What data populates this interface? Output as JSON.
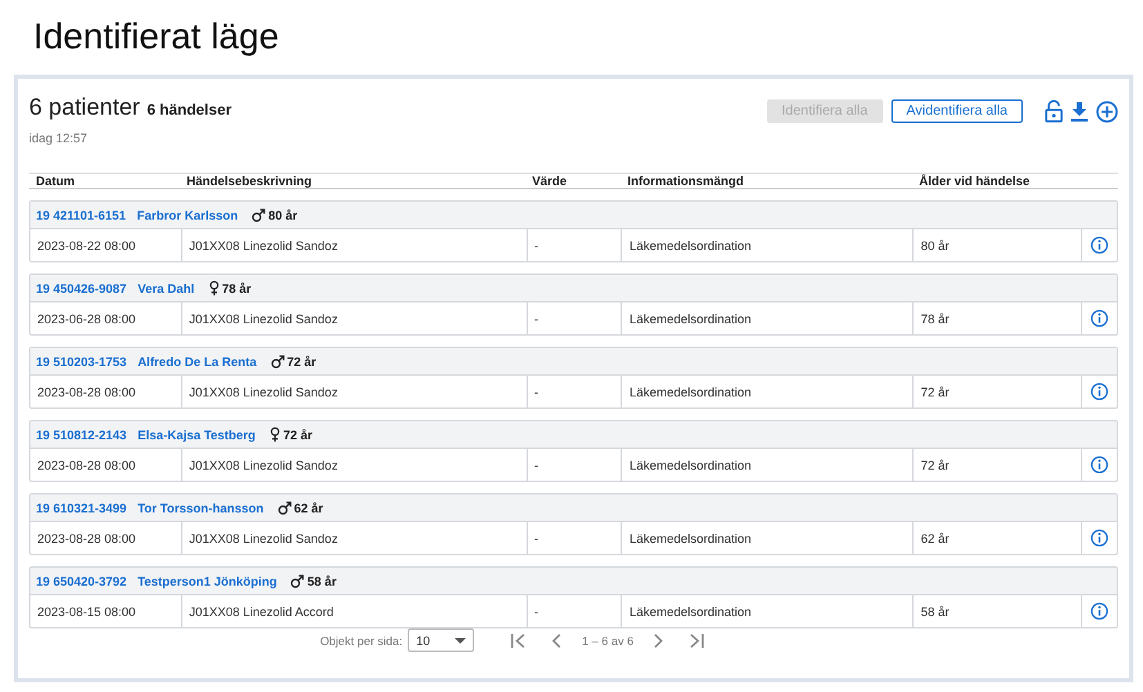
{
  "page_title": "Identifierat läge",
  "summary": {
    "patients": "6 patienter",
    "events": "6 händelser",
    "updated": "idag 12:57"
  },
  "buttons": [
    {
      "label": "Identifiera alla",
      "disabled": true
    },
    {
      "label": "Avidentifiera alla",
      "disabled": false
    }
  ],
  "table": {
    "columns": [
      "Datum",
      "Händelsebeskrivning",
      "Värde",
      "Informationsmängd",
      "Ålder vid händelse"
    ],
    "groups": [
      {
        "id": "19 421101-6151",
        "name": "Farbror Karlsson",
        "kind": "male",
        "age": "80 år",
        "rows": [
          [
            "2023-08-22 08:00",
            "J01XX08 Linezolid Sandoz",
            "-",
            "Läkemedelsordination",
            "80 år"
          ]
        ]
      },
      {
        "id": "19 450426-9087",
        "name": "Vera Dahl",
        "kind": "female",
        "age": "78 år",
        "rows": [
          [
            "2023-06-28 08:00",
            "J01XX08 Linezolid Sandoz",
            "-",
            "Läkemedelsordination",
            "78 år"
          ]
        ]
      },
      {
        "id": "19 510203-1753",
        "name": "Alfredo De La Renta",
        "kind": "male",
        "age": "72 år",
        "rows": [
          [
            "2023-08-28 08:00",
            "J01XX08 Linezolid Sandoz",
            "-",
            "Läkemedelsordination",
            "72 år"
          ]
        ]
      },
      {
        "id": "19 510812-2143",
        "name": "Elsa-Kajsa Testberg",
        "kind": "female",
        "age": "72 år",
        "rows": [
          [
            "2023-08-28 08:00",
            "J01XX08 Linezolid Sandoz",
            "-",
            "Läkemedelsordination",
            "72 år"
          ]
        ]
      },
      {
        "id": "19 610321-3499",
        "name": "Tor Torsson-hansson",
        "kind": "male",
        "age": "62 år",
        "rows": [
          [
            "2023-08-28 08:00",
            "J01XX08 Linezolid Sandoz",
            "-",
            "Läkemedelsordination",
            "62 år"
          ]
        ]
      },
      {
        "id": "19 650420-3792",
        "name": "Testperson1 Jönköping",
        "kind": "male",
        "age": "58 år",
        "rows": [
          [
            "2023-08-15 08:00",
            "J01XX08 Linezolid Accord",
            "-",
            "Läkemedelsordination",
            "58 år"
          ]
        ]
      }
    ]
  },
  "pagination": {
    "label": "Objekt per sida:",
    "per_page": "10",
    "range": "1 – 6 av 6"
  }
}
